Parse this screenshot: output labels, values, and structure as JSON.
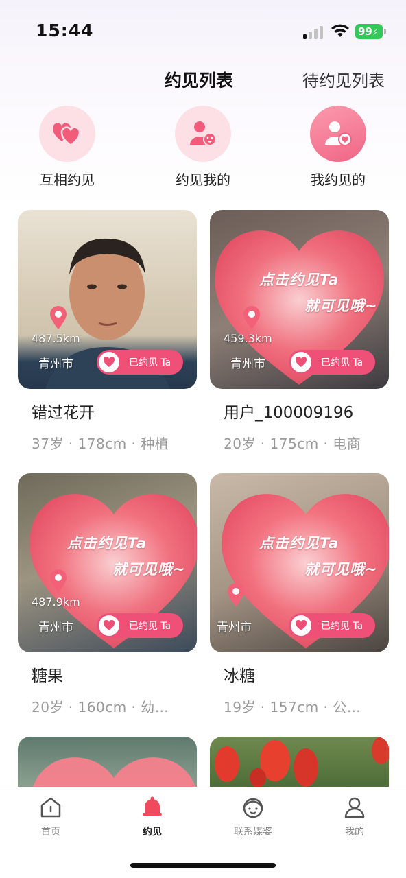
{
  "status_bar": {
    "time": "15:44",
    "battery": "99"
  },
  "header": {
    "tab_active": "约见列表",
    "tab_other": "待约见列表"
  },
  "categories": [
    {
      "label": "互相约见",
      "icon": "double-heart-icon"
    },
    {
      "label": "约见我的",
      "icon": "person-kiss-icon"
    },
    {
      "label": "我约见的",
      "icon": "person-heart-icon"
    }
  ],
  "promo": {
    "line1": "点击约见Ta",
    "line2": "就可见哦~"
  },
  "badge_label": "已约见 Ta",
  "cards": [
    {
      "name": "错过花开",
      "info": "37岁 · 178cm · 种植",
      "distance": "487.5km",
      "city": "青州市"
    },
    {
      "name": "用户_100009196",
      "info": "20岁 · 175cm · 电商",
      "distance": "459.3km",
      "city": "青州市"
    },
    {
      "name": "糖果",
      "info": "20岁 · 160cm · 幼…",
      "distance": "487.9km",
      "city": "青州市"
    },
    {
      "name": "冰糖",
      "info": "19岁 · 157cm · 公…",
      "distance": "",
      "city": "青州市"
    }
  ],
  "nav": [
    {
      "label": "首页",
      "icon": "home-icon"
    },
    {
      "label": "约见",
      "icon": "bell-icon"
    },
    {
      "label": "联系媒婆",
      "icon": "matchmaker-icon"
    },
    {
      "label": "我的",
      "icon": "profile-icon"
    }
  ],
  "colors": {
    "accent": "#ee5078",
    "heart": "#f26a7c",
    "pale_pink": "#fde0e6"
  }
}
